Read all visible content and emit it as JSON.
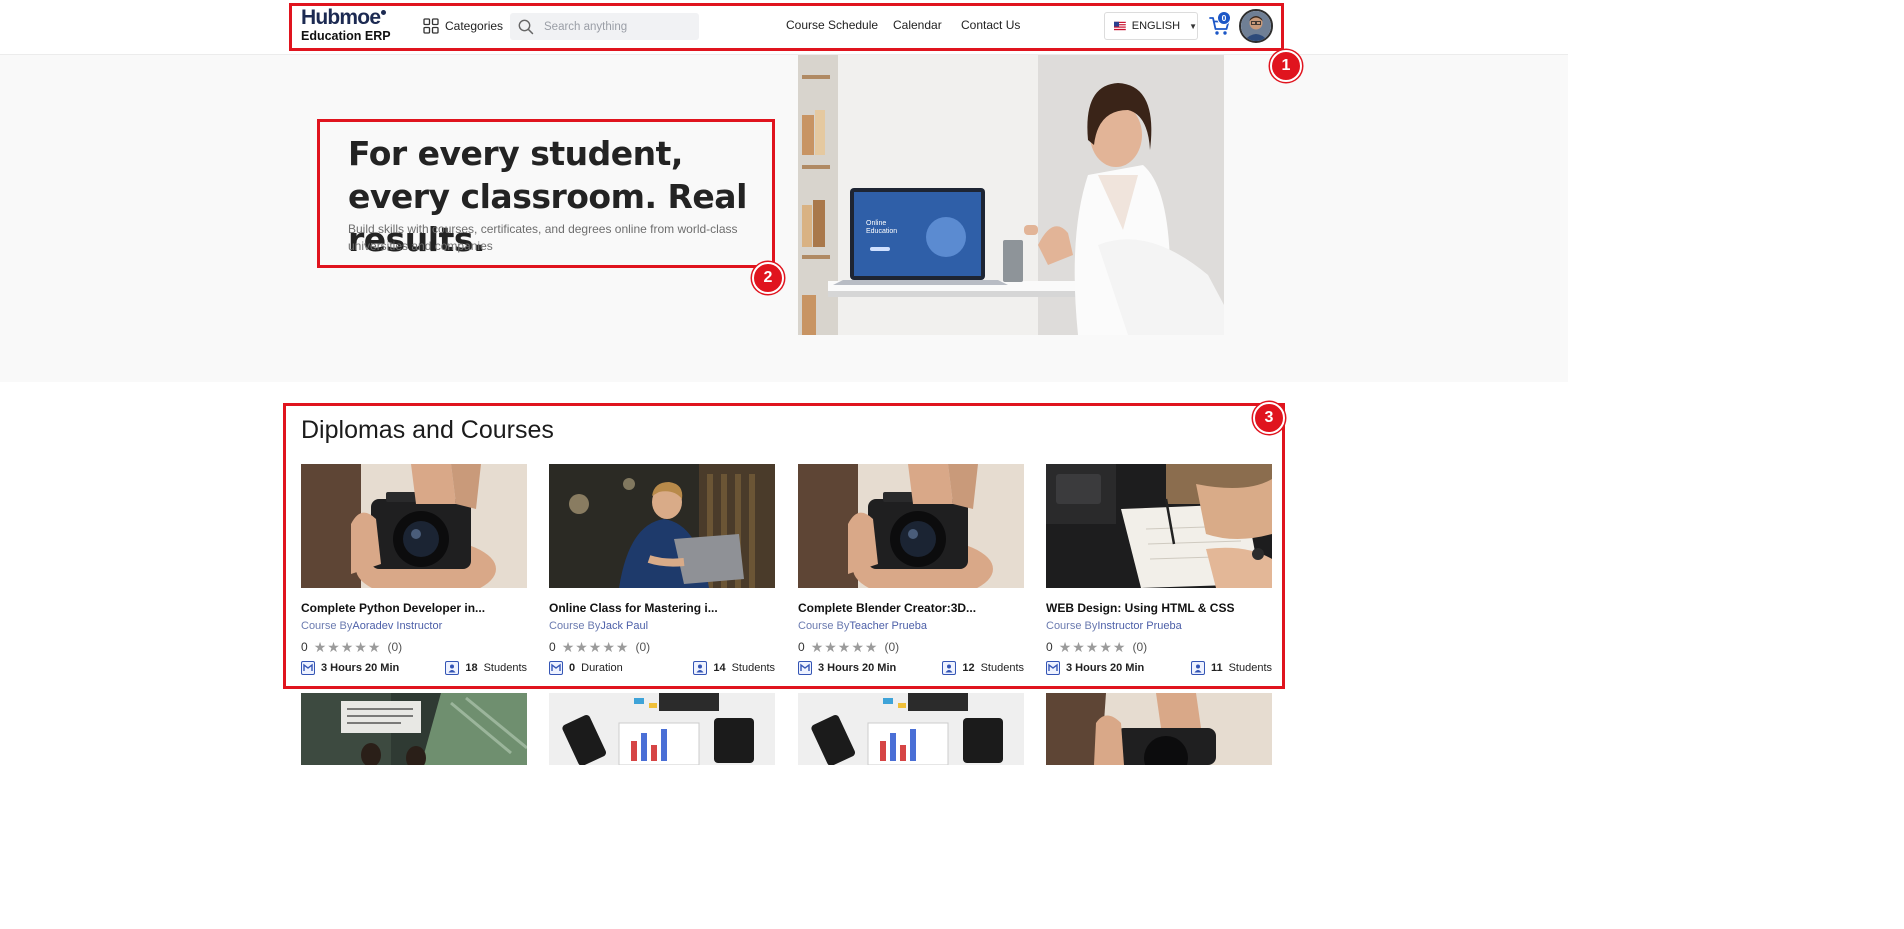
{
  "header": {
    "logo_top": "Hubmoe",
    "logo_sub": "Education ERP",
    "categories_label": "Categories",
    "search_placeholder": "Search anything",
    "nav": [
      "Course Schedule",
      "Calendar",
      "Contact Us"
    ],
    "language": "ENGLISH",
    "cart_count": "0"
  },
  "hero": {
    "title": "For every student, every classroom. Real results.",
    "subtitle": "Build skills with courses, certificates, and degrees online from world-class universities and companies"
  },
  "section": {
    "title": "Diplomas and Courses"
  },
  "courses": [
    {
      "title": "Complete Python Developer in...",
      "by_prefix": "Course By",
      "instructor": "Aoradev Instructor",
      "rating": "0",
      "reviews": "(0)",
      "duration_value": "3 Hours 20 Min",
      "duration_suffix": "",
      "students_count": "18",
      "students_label": "Students",
      "image": "camera"
    },
    {
      "title": "Online Class for Mastering i...",
      "by_prefix": "Course By",
      "instructor": "Jack Paul",
      "rating": "0",
      "reviews": "(0)",
      "duration_value": "0",
      "duration_suffix": "Duration",
      "students_count": "14",
      "students_label": "Students",
      "image": "laptop-man"
    },
    {
      "title": "Complete Blender Creator:3D...",
      "by_prefix": "Course By",
      "instructor": "Teacher Prueba",
      "rating": "0",
      "reviews": "(0)",
      "duration_value": "3 Hours 20 Min",
      "duration_suffix": "",
      "students_count": "12",
      "students_label": "Students",
      "image": "camera"
    },
    {
      "title": "WEB Design: Using HTML & CSS",
      "by_prefix": "Course By",
      "instructor": "Instructor Prueba",
      "rating": "0",
      "reviews": "(0)",
      "duration_value": "3 Hours 20 Min",
      "duration_suffix": "",
      "students_count": "11",
      "students_label": "Students",
      "image": "writing"
    }
  ],
  "annotations": [
    "1",
    "2",
    "3"
  ],
  "colors": {
    "annotation": "#e0141e",
    "brand": "#2c3f85",
    "accent": "#1c57c7"
  },
  "icons": [
    "grid-icon",
    "search-icon",
    "us-flag-icon",
    "cart-icon",
    "star-icon",
    "duration-icon",
    "students-icon"
  ]
}
